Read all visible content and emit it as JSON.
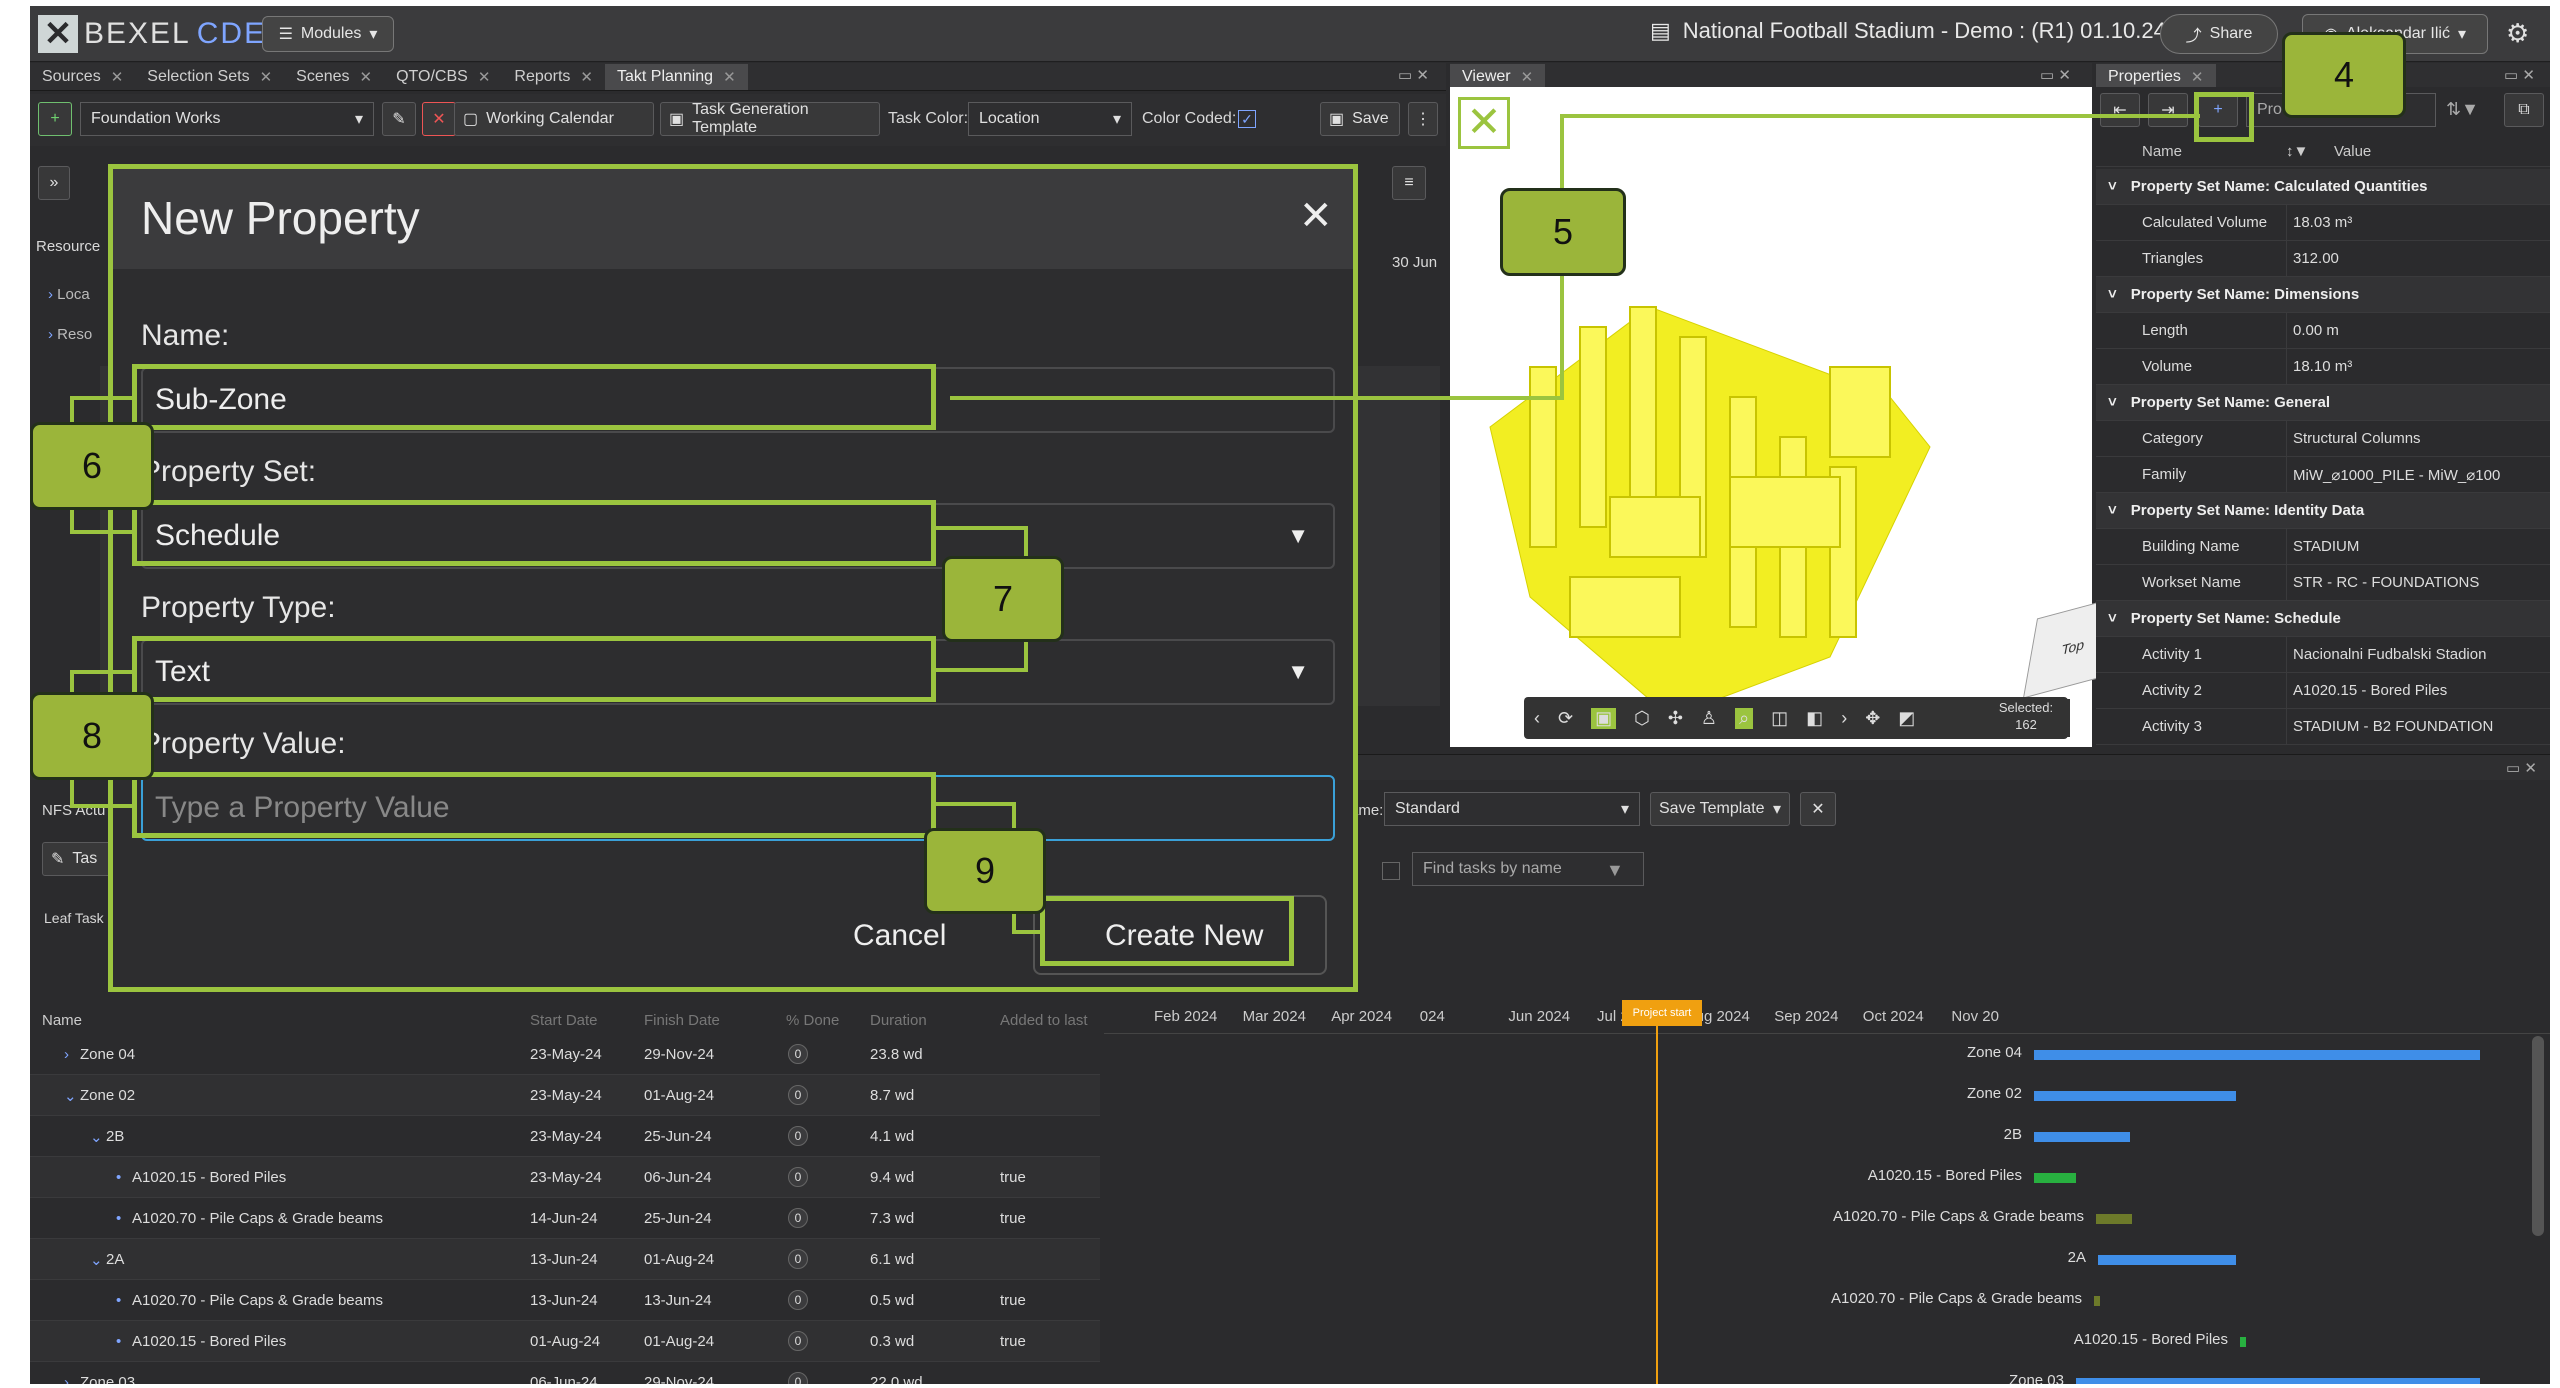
{
  "app": {
    "logo_a": "BEXEL",
    "logo_b": "CDE",
    "modules_label": "Modules",
    "project_title": "National Football Stadium - Demo : (R1) 01.10.24",
    "share_label": "Share",
    "user_label": "Aleksandar Ilić"
  },
  "tabs": [
    "Sources",
    "Selection Sets",
    "Scenes",
    "QTO/CBS",
    "Reports",
    "Takt Planning"
  ],
  "viewer_tab": "Viewer",
  "properties_tab": "Properties",
  "toolbar": {
    "schedule_select": "Foundation Works",
    "working_calendar": "Working Calendar",
    "task_template": "Task Generation Template",
    "task_color_label": "Task Color:",
    "task_color_value": "Location",
    "color_coded_label": "Color Coded:",
    "save_label": "Save"
  },
  "left_panel": {
    "resource_label": "Resource",
    "date_label": "30 Jun",
    "tree_items": [
      "Loca",
      "Reso"
    ],
    "nfs_label": "NFS Actu",
    "leaf_task_label": "Leaf Task",
    "task_btn": "Tas"
  },
  "filter_bar": {
    "template_label": "ame:",
    "template_value": "Standard",
    "save_template": "Save Template",
    "find_placeholder": "Find tasks by name"
  },
  "modal": {
    "title": "New Property",
    "name_label": "Name:",
    "name_value": "Sub-Zone",
    "set_label": "Property Set:",
    "set_value": "Schedule",
    "type_label": "Property Type:",
    "type_value": "Text",
    "value_label": "Property Value:",
    "value_placeholder": "Type a Property Value",
    "cancel_label": "Cancel",
    "create_label": "Create New"
  },
  "callouts": {
    "c4": "4",
    "c5": "5",
    "c6": "6",
    "c7": "7",
    "c8": "8",
    "c9": "9"
  },
  "viewer": {
    "selected_label": "Selected:",
    "selected_count": "162",
    "cube_label": "Top"
  },
  "properties": {
    "search_placeholder": "Pro",
    "col_name": "Name",
    "col_value": "Value",
    "groups": [
      {
        "title": "Property Set Name: Calculated Quantities",
        "rows": [
          [
            "Calculated Volume",
            "18.03 m³"
          ],
          [
            "Triangles",
            "312.00"
          ]
        ]
      },
      {
        "title": "Property Set Name: Dimensions",
        "rows": [
          [
            "Length",
            "0.00 m"
          ],
          [
            "Volume",
            "18.10 m³"
          ]
        ]
      },
      {
        "title": "Property Set Name: General",
        "rows": [
          [
            "Category",
            "Structural Columns"
          ],
          [
            "Family",
            "MiW_⌀1000_PILE - MiW_⌀100"
          ]
        ]
      },
      {
        "title": "Property Set Name: Identity Data",
        "rows": [
          [
            "Building Name",
            "STADIUM"
          ],
          [
            "Workset Name",
            "STR - RC - FOUNDATIONS"
          ]
        ]
      },
      {
        "title": "Property Set Name: Schedule",
        "rows": [
          [
            "Activity 1",
            "Nacionalni Fudbalski Stadion"
          ],
          [
            "Activity 2",
            "A1020.15 - Bored Piles"
          ],
          [
            "Activity 3",
            "STADIUM - B2 FOUNDATION"
          ]
        ]
      }
    ]
  },
  "tasks": {
    "headers": [
      "Name",
      "Start Date",
      "Finish Date",
      "% Done",
      "Duration",
      "Added to last"
    ],
    "rows": [
      [
        "Zone 04",
        "23-May-24",
        "29-Nov-24",
        "0",
        "23.8 wd",
        ""
      ],
      [
        "Zone 02",
        "23-May-24",
        "01-Aug-24",
        "0",
        "8.7 wd",
        ""
      ],
      [
        "2B",
        "23-May-24",
        "25-Jun-24",
        "0",
        "4.1 wd",
        ""
      ],
      [
        "A1020.15 - Bored Piles",
        "23-May-24",
        "06-Jun-24",
        "0",
        "9.4 wd",
        "true"
      ],
      [
        "A1020.70 - Pile Caps & Grade beams",
        "14-Jun-24",
        "25-Jun-24",
        "0",
        "7.3 wd",
        "true"
      ],
      [
        "2A",
        "13-Jun-24",
        "01-Aug-24",
        "0",
        "6.1 wd",
        ""
      ],
      [
        "A1020.70 - Pile Caps & Grade beams",
        "13-Jun-24",
        "13-Jun-24",
        "0",
        "0.5 wd",
        "true"
      ],
      [
        "A1020.15 - Bored Piles",
        "01-Aug-24",
        "01-Aug-24",
        "0",
        "0.3 wd",
        "true"
      ],
      [
        "Zone 03",
        "06-Jun-24",
        "29-Nov-24",
        "0",
        "22.0 wd",
        ""
      ]
    ]
  },
  "gantt": {
    "year": "2024",
    "months": [
      "Feb 2024",
      "Mar 2024",
      "Apr 2024",
      "024",
      "Jun 2024",
      "Jul 2024",
      "Aug 2024",
      "Sep 2024",
      "Oct 2024",
      "Nov 20"
    ],
    "project_start": "Project start",
    "bar_labels": [
      "Zone 04",
      "Zone 02",
      "2B",
      "A1020.15 - Bored Piles",
      "A1020.70 - Pile Caps & Grade beams",
      "2A",
      "A1020.70 - Pile Caps & Grade beams",
      "A1020.15 - Bored Piles",
      "Zone 03"
    ]
  },
  "colors": {
    "accent_green": "#9bc43f",
    "callout_fill": "#9bb53a",
    "bar_blue": "#3f8ee8",
    "model_yellow": "#f4f020"
  }
}
